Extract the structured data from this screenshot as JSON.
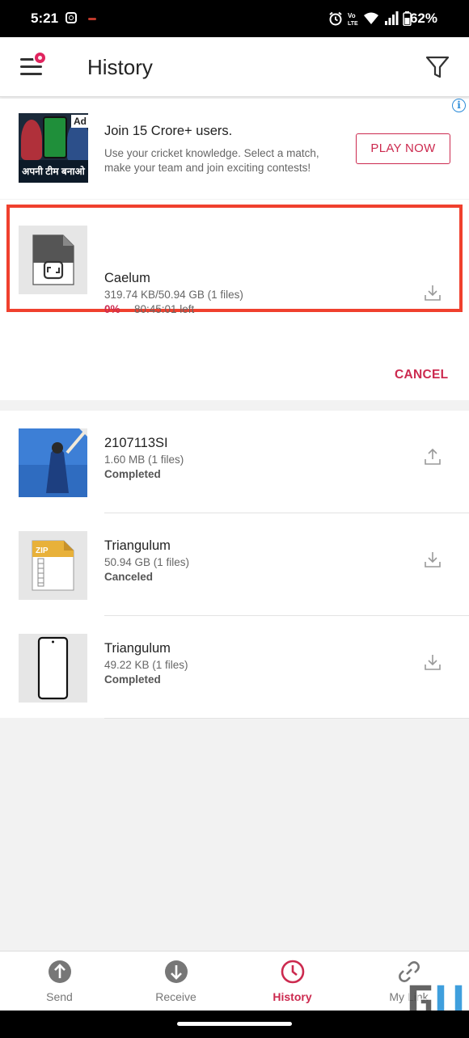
{
  "status_bar": {
    "time": "5:21",
    "battery": "62%"
  },
  "header": {
    "title": "History"
  },
  "ad": {
    "badge": "Ad",
    "info": "i",
    "image_banner": "अपनी टीम बनाओ",
    "headline": "Join 15 Crore+ users.",
    "body": "Use your cricket knowledge. Select a match, make your team and join exciting contests!",
    "cta": "PLAY NOW"
  },
  "active_transfer": {
    "name": "Caelum",
    "size": "319.74 KB/50.94 GB (1 files)",
    "progress_text": "0%",
    "progress": 0,
    "time_left": "80:45:01 left",
    "cancel_label": "CANCEL",
    "action_icon": "download-icon"
  },
  "history": [
    {
      "name": "2107113SI",
      "size": "1.60 MB (1 files)",
      "status": "Completed",
      "thumb": "photo-thumb",
      "action_icon": "upload-icon"
    },
    {
      "name": "Triangulum",
      "size": "50.94 GB (1 files)",
      "status": "Canceled",
      "thumb": "zip-file-icon",
      "zip_label": "ZIP",
      "action_icon": "download-icon"
    },
    {
      "name": "Triangulum",
      "size": "49.22 KB (1 files)",
      "status": "Completed",
      "thumb": "phone-thumb",
      "action_icon": "download-icon"
    }
  ],
  "bottom_nav": [
    {
      "label": "Send",
      "icon": "send-icon",
      "active": false
    },
    {
      "label": "Receive",
      "icon": "receive-icon",
      "active": false
    },
    {
      "label": "History",
      "icon": "history-icon",
      "active": true
    },
    {
      "label": "My Link",
      "icon": "link-icon",
      "active": false
    }
  ],
  "colors": {
    "accent": "#cc2a4f",
    "highlight_box": "#f0402e",
    "background": "#f2f2f2"
  }
}
